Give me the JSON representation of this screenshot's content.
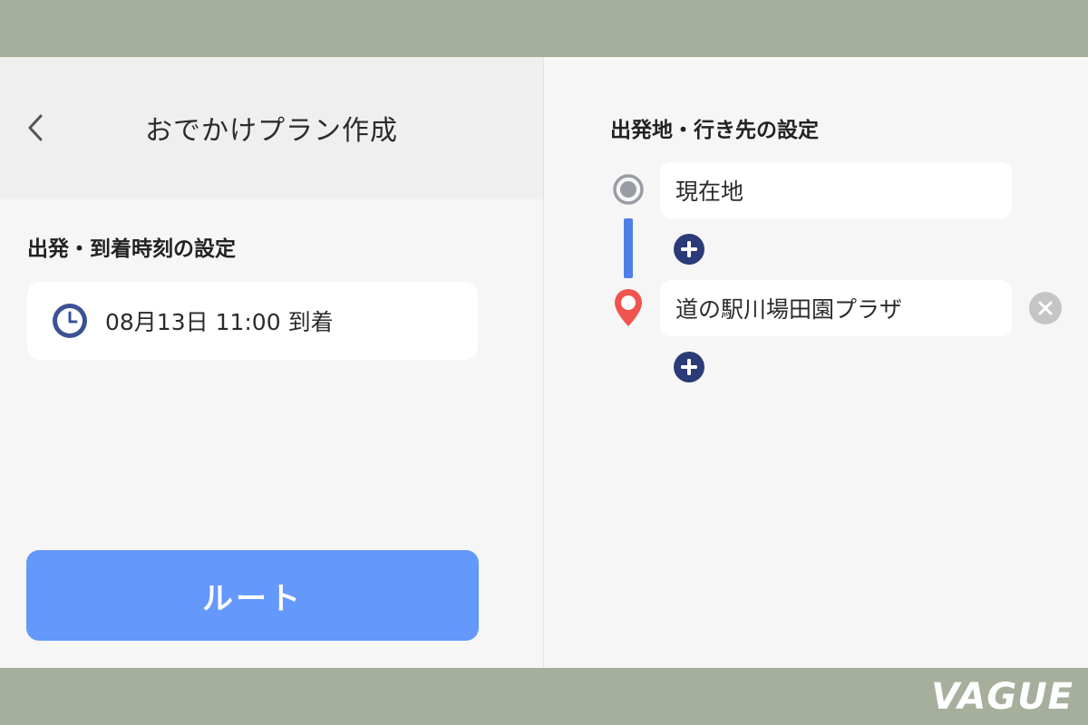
{
  "left_panel": {
    "header": {
      "back_icon": "chevron-left-icon",
      "title": "おでかけプラン作成"
    },
    "time_section": {
      "heading": "出発・到着時刻の設定",
      "clock_icon": "clock-icon",
      "time_value": "08月13日 11:00 到着"
    },
    "route_button_label": "ルート"
  },
  "right_panel": {
    "heading": "出発地・行き先の設定",
    "origin": {
      "icon": "origin-dot-icon",
      "value": "現在地"
    },
    "destination": {
      "icon": "map-pin-icon",
      "value": "道の駅川場田園プラザ"
    },
    "add_icon": "plus-circle-icon",
    "clear_icon": "clear-icon"
  },
  "watermark": "VAGUE",
  "colors": {
    "frame": "#a6af9b",
    "route_button": "#6498fb",
    "route_line": "#4f7fe4",
    "add_button": "#2b3b78",
    "pin": "#f0544f",
    "clock": "#3b5293"
  }
}
